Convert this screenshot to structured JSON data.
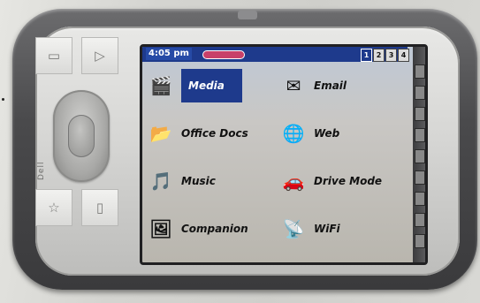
{
  "device": {
    "brand_label": "Dell"
  },
  "statusbar": {
    "time": "4:05 pm",
    "tabs": [
      "1",
      "2",
      "3",
      "4"
    ],
    "active_tab": "1"
  },
  "menu": {
    "left": [
      {
        "label": "Media",
        "icon": "media-icon",
        "selected": true
      },
      {
        "label": "Office Docs",
        "icon": "office-docs-icon",
        "selected": false
      },
      {
        "label": "Music",
        "icon": "music-icon",
        "selected": false
      },
      {
        "label": "Companion",
        "icon": "companion-icon",
        "selected": false
      }
    ],
    "right": [
      {
        "label": "Email",
        "icon": "email-icon",
        "selected": false
      },
      {
        "label": "Web",
        "icon": "web-icon",
        "selected": false
      },
      {
        "label": "Drive Mode",
        "icon": "drive-mode-icon",
        "selected": false
      },
      {
        "label": "WiFi",
        "icon": "wifi-icon",
        "selected": false
      }
    ]
  },
  "colors": {
    "accent": "#1e3a8c",
    "pill": "#c8406a"
  }
}
